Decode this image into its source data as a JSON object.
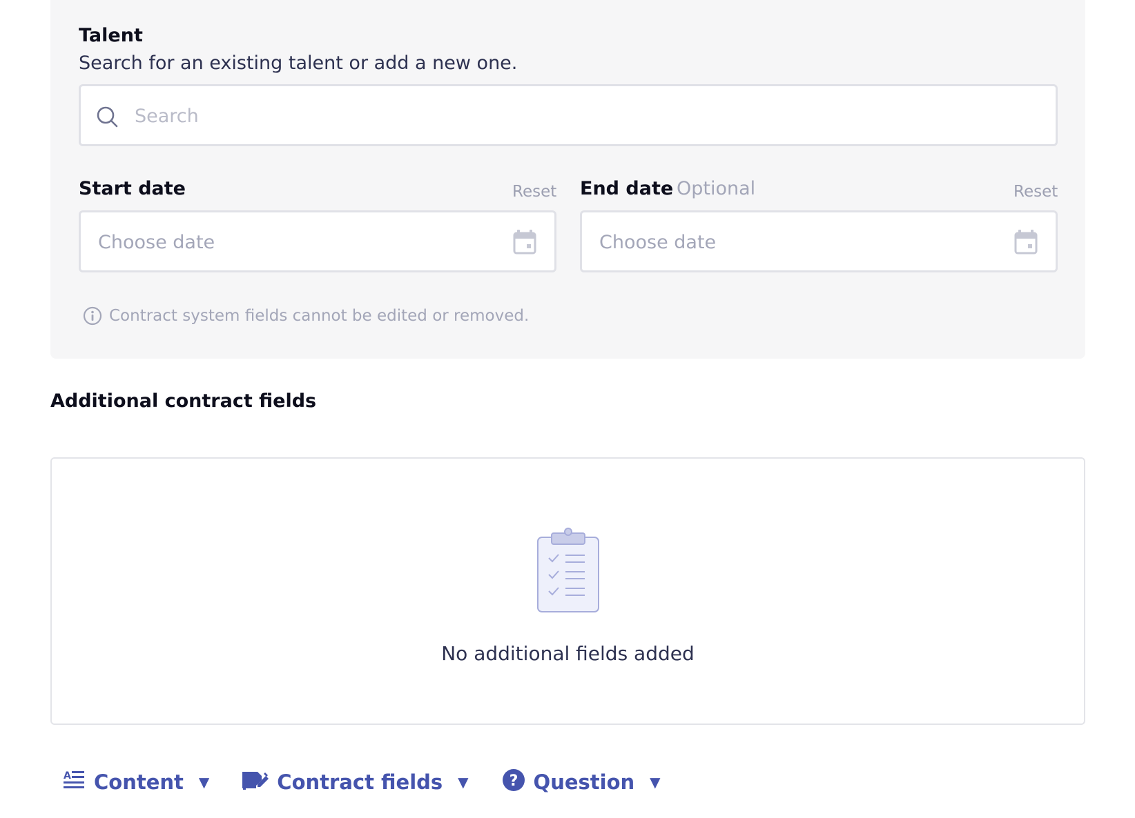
{
  "talent": {
    "title": "Talent",
    "description": "Search for an existing talent or add a new one.",
    "search_placeholder": "Search",
    "search_value": ""
  },
  "start_date": {
    "label": "Start date",
    "reset_label": "Reset",
    "placeholder": "Choose date",
    "value": ""
  },
  "end_date": {
    "label": "End date",
    "optional_label": "Optional",
    "reset_label": "Reset",
    "placeholder": "Choose date",
    "value": ""
  },
  "info": {
    "text": "Contract system fields cannot be edited or removed."
  },
  "additional": {
    "title": "Additional contract fields",
    "empty_text": "No additional fields added"
  },
  "toolbar": {
    "content_label": "Content",
    "contract_fields_label": "Contract fields",
    "question_label": "Question",
    "caret": "▼"
  },
  "colors": {
    "accent": "#4554ad",
    "panel_bg": "#f6f6f7",
    "muted_text": "#a3a6b8",
    "border": "#e0e1e7"
  },
  "icons": {
    "search": "search-icon",
    "calendar": "calendar-icon",
    "info": "info-icon",
    "clipboard": "clipboard-checklist-icon",
    "content": "text-lines-icon",
    "contract_fields": "edit-document-icon",
    "question": "question-circle-icon"
  }
}
